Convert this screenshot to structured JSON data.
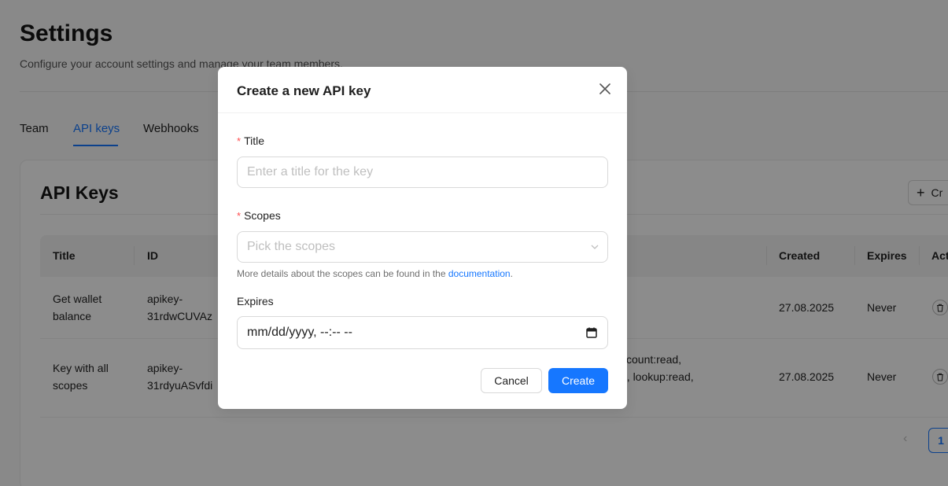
{
  "page": {
    "title": "Settings",
    "subtitle": "Configure your account settings and manage your team members."
  },
  "tabs": [
    {
      "label": "Team"
    },
    {
      "label": "API keys",
      "active": true
    },
    {
      "label": "Webhooks"
    }
  ],
  "api_keys": {
    "title": "API Keys",
    "create_label": "Cr",
    "columns": [
      "Title",
      "ID",
      "Created",
      "Expires",
      "Act"
    ],
    "rows": [
      {
        "title_line1": "Get wallet",
        "title_line2": "balance",
        "id_line1": "apikey-",
        "id_line2": "31rdwCUVAz",
        "scopes_line1": "",
        "scopes_line2": "",
        "created": "27.08.2025",
        "expires": "Never"
      },
      {
        "title_line1": "Key with all",
        "title_line2": "scopes",
        "id_line1": "apikey-",
        "id_line2": "31rdyuASvfdi",
        "scopes_line1": "ccount:read,",
        "scopes_line2": "e, lookup:read,",
        "created": "27.08.2025",
        "expires": "Never"
      }
    ],
    "pagination": {
      "current_page": "1"
    }
  },
  "modal": {
    "title": "Create a new API key",
    "title_field": {
      "label": "Title",
      "placeholder": "Enter a title for the key"
    },
    "scopes_field": {
      "label": "Scopes",
      "placeholder": "Pick the scopes"
    },
    "help_text": "More details about the scopes can be found in the ",
    "help_link": "documentation",
    "help_end": ".",
    "expires_field": {
      "label": "Expires",
      "value": "mm/dd/yyyy, --:-- --"
    },
    "cancel_label": "Cancel",
    "create_label": "Create"
  },
  "colors": {
    "accent": "#1677ff",
    "required": "#ff4d4f",
    "overlay": "rgba(0,0,0,0.45)"
  }
}
